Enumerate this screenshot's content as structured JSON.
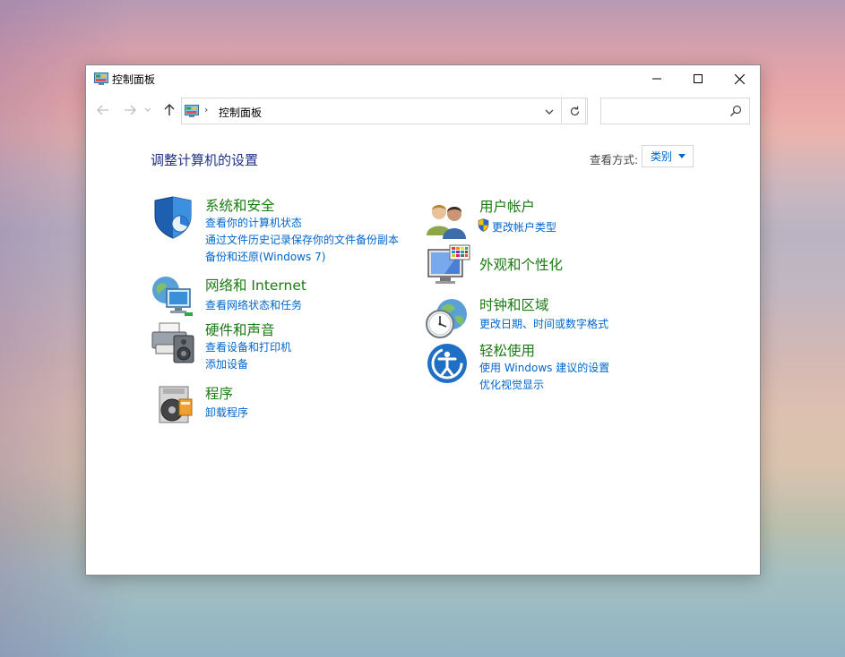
{
  "window": {
    "title": "控制面板",
    "icons": {
      "app": "control-panel-icon",
      "minimize": "minimize-icon",
      "maximize": "maximize-icon",
      "close": "close-icon"
    }
  },
  "navbar": {
    "back_icon": "back-arrow-icon",
    "forward_icon": "forward-arrow-icon",
    "recent_icon": "chevron-down-icon",
    "up_icon": "up-arrow-icon",
    "address_separator": "›",
    "address_text": "控制面板",
    "refresh_icon": "refresh-icon",
    "search_placeholder": "",
    "search_icon": "search-icon"
  },
  "main": {
    "heading": "调整计算机的设置",
    "view_by_label": "查看方式:",
    "view_by_value": "类别"
  },
  "categories_left": [
    {
      "title": "系统和安全",
      "icon": "shield-icon",
      "links": [
        "查看你的计算机状态",
        "通过文件历史记录保存你的文件备份副本",
        "备份和还原(Windows 7)"
      ]
    },
    {
      "title": "网络和 Internet",
      "icon": "network-globe-icon",
      "links": [
        "查看网络状态和任务"
      ]
    },
    {
      "title": "硬件和声音",
      "icon": "printer-speaker-icon",
      "links": [
        "查看设备和打印机",
        "添加设备"
      ]
    },
    {
      "title": "程序",
      "icon": "programs-disc-icon",
      "links": [
        "卸载程序"
      ]
    }
  ],
  "categories_right": [
    {
      "title": "用户帐户",
      "icon": "users-icon",
      "links": [
        "更改帐户类型"
      ],
      "link_icon": "uac-shield-icon"
    },
    {
      "title": "外观和个性化",
      "icon": "monitor-palette-icon",
      "links": []
    },
    {
      "title": "时钟和区域",
      "icon": "clock-globe-icon",
      "links": [
        "更改日期、时间或数字格式"
      ]
    },
    {
      "title": "轻松使用",
      "icon": "accessibility-icon",
      "links": [
        "使用 Windows 建议的设置",
        "优化视觉显示"
      ]
    }
  ],
  "colors": {
    "category_title": "#1a7b11",
    "link": "#0066cc",
    "heading": "#1e3287"
  }
}
